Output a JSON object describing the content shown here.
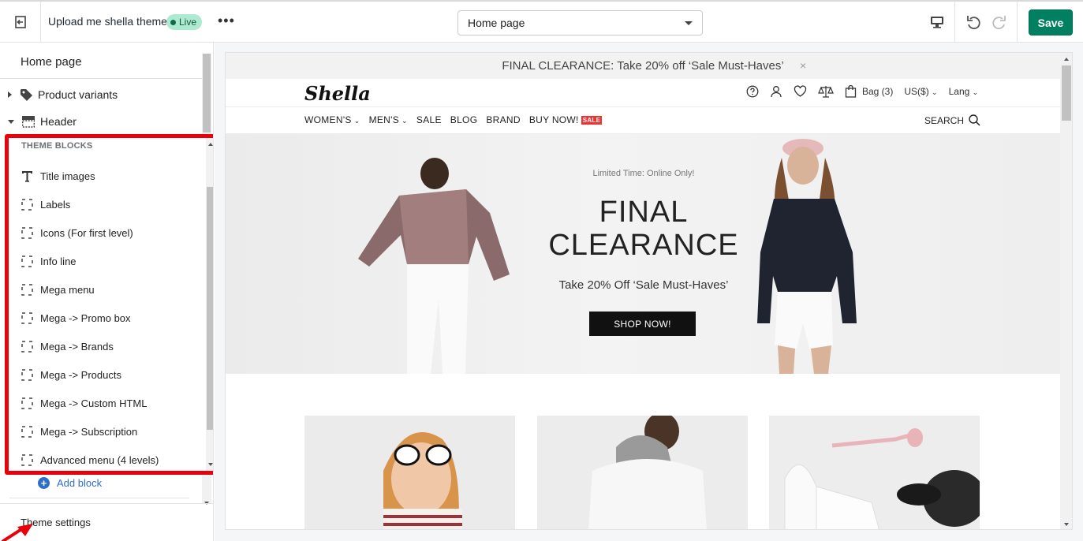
{
  "topbar": {
    "theme_name": "Upload me shella theme",
    "live_label": "Live",
    "more_label": "•••",
    "page_select": "Home page",
    "save_label": "Save"
  },
  "sidebar": {
    "title": "Home page",
    "items": [
      {
        "label": "Product variants",
        "icon": "tag-icon",
        "expanded": false
      },
      {
        "label": "Header",
        "icon": "header-icon",
        "expanded": true
      }
    ],
    "blocks_heading": "THEME BLOCKS",
    "blocks": [
      {
        "label": "Title images",
        "icon": "text-icon"
      },
      {
        "label": "Labels",
        "icon": "block-icon"
      },
      {
        "label": "Icons (For first level)",
        "icon": "block-icon"
      },
      {
        "label": "Info line",
        "icon": "block-icon"
      },
      {
        "label": "Mega menu",
        "icon": "block-icon"
      },
      {
        "label": "Mega -> Promo box",
        "icon": "block-icon"
      },
      {
        "label": "Mega -> Brands",
        "icon": "block-icon"
      },
      {
        "label": "Mega -> Products",
        "icon": "block-icon"
      },
      {
        "label": "Mega -> Custom HTML",
        "icon": "block-icon"
      },
      {
        "label": "Mega -> Subscription",
        "icon": "block-icon"
      },
      {
        "label": "Advanced menu (4 levels)",
        "icon": "block-icon"
      }
    ],
    "add_block": "Add block",
    "theme_settings": "Theme settings"
  },
  "preview": {
    "announcement": "FINAL CLEARANCE: Take 20% off ‘Sale Must-Haves’",
    "announcement_close": "×",
    "logo": "Shella",
    "bag": "Bag (3)",
    "currency": "US($)",
    "lang": "Lang",
    "nav": [
      {
        "label": "WOMEN'S",
        "dropdown": true
      },
      {
        "label": "MEN'S",
        "dropdown": true
      },
      {
        "label": "SALE",
        "dropdown": false
      },
      {
        "label": "BLOG",
        "dropdown": false
      },
      {
        "label": "BRAND",
        "dropdown": false
      },
      {
        "label": "BUY NOW!",
        "dropdown": false,
        "tag": "SALE"
      }
    ],
    "search": "SEARCH",
    "hero": {
      "eyebrow": "Limited Time: Online Only!",
      "title_line1": "FINAL",
      "title_line2": "CLEARANCE",
      "subtitle": "Take 20% Off ‘Sale Must-Haves’",
      "button": "SHOP NOW!"
    }
  },
  "colors": {
    "accent": "#008060",
    "highlight": "#e8000b",
    "link": "#2c6ecb",
    "live_badge": "#aee9d1"
  }
}
